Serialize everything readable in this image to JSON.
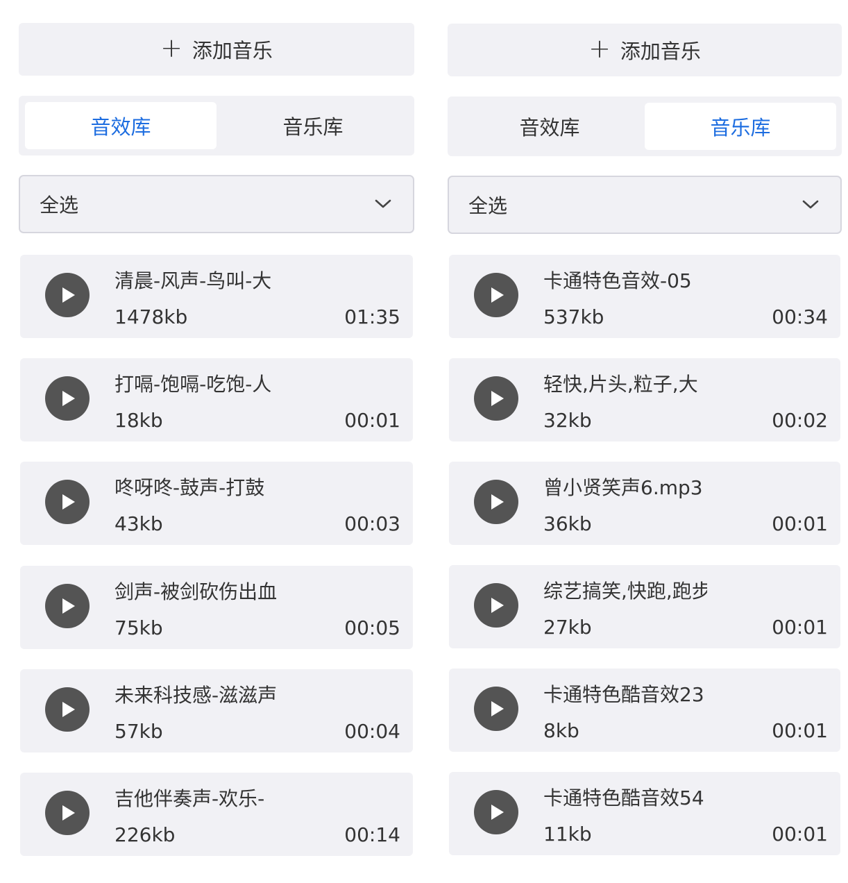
{
  "left": {
    "add_button": {
      "icon": "plus-icon",
      "label": "添加音乐"
    },
    "tabs": [
      {
        "label": "音效库",
        "active": true
      },
      {
        "label": "音乐库",
        "active": false
      }
    ],
    "select": {
      "value": "全选",
      "icon": "chevron-down-icon"
    },
    "items": [
      {
        "name": "清晨-风声-鸟叫-大",
        "size": "1478kb",
        "duration": "01:35"
      },
      {
        "name": "打嗝-饱嗝-吃饱-人",
        "size": "18kb",
        "duration": "00:01"
      },
      {
        "name": "咚呀咚-鼓声-打鼓",
        "size": "43kb",
        "duration": "00:03"
      },
      {
        "name": "剑声-被剑砍伤出血",
        "size": "75kb",
        "duration": "00:05"
      },
      {
        "name": "未来科技感-滋滋声",
        "size": "57kb",
        "duration": "00:04"
      },
      {
        "name": "吉他伴奏声-欢乐-",
        "size": "226kb",
        "duration": "00:14"
      }
    ]
  },
  "right": {
    "add_button": {
      "icon": "plus-icon",
      "label": "添加音乐"
    },
    "tabs": [
      {
        "label": "音效库",
        "active": false
      },
      {
        "label": "音乐库",
        "active": true
      }
    ],
    "select": {
      "value": "全选",
      "icon": "chevron-down-icon"
    },
    "items": [
      {
        "name": "卡通特色音效-05",
        "size": "537kb",
        "duration": "00:34"
      },
      {
        "name": "轻快,片头,粒子,大",
        "size": "32kb",
        "duration": "00:02"
      },
      {
        "name": "曾小贤笑声6.mp3",
        "size": "36kb",
        "duration": "00:01"
      },
      {
        "name": "综艺搞笑,快跑,跑步",
        "size": "27kb",
        "duration": "00:01"
      },
      {
        "name": "卡通特色酷音效23",
        "size": "8kb",
        "duration": "00:01"
      },
      {
        "name": "卡通特色酷音效54",
        "size": "11kb",
        "duration": "00:01"
      }
    ]
  },
  "colors": {
    "accent": "#1d6de0",
    "surface": "#f1f1f5",
    "play_button": "#545454",
    "text": "#333333"
  }
}
